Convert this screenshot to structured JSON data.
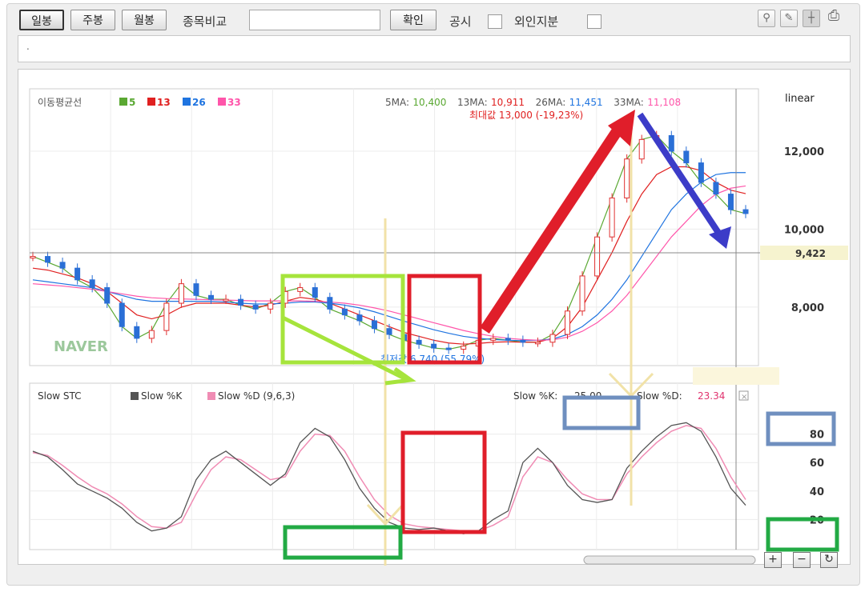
{
  "toolbar": {
    "period_buttons": [
      "일봉",
      "주봉",
      "월봉"
    ],
    "compare_label": "종목비교",
    "compare_value": "",
    "confirm_button": "확인",
    "disclosure_label": "공시",
    "foreign_label": "외인지분"
  },
  "subbar": {
    "text": "."
  },
  "price_chart": {
    "ma_title": "이동평균선",
    "ma_periods": [
      "5",
      "13",
      "26",
      "33"
    ],
    "ma_colors": [
      "#5aa832",
      "#e02020",
      "#1f74e0",
      "#ff55aa"
    ],
    "ma_readout": [
      {
        "label": "5MA:",
        "value": "10,400"
      },
      {
        "label": "13MA:",
        "value": "10,911"
      },
      {
        "label": "26MA:",
        "value": "11,451"
      },
      {
        "label": "33MA:",
        "value": "11,108"
      }
    ],
    "scale_label": "linear",
    "max_label": "최대값 13,000 (-19,23%)",
    "min_label": "최저값 6,740 (55,79%)",
    "current_price": "9,422",
    "watermark": "NAVER",
    "y_ticks": [
      "12,000",
      "10,000",
      "8,000"
    ]
  },
  "stoch_chart": {
    "title": "Slow STC",
    "k_legend": "Slow %K",
    "d_legend": "Slow %D (9,6,3)",
    "readout_k_label": "Slow %K:",
    "readout_k_value": "25.00",
    "readout_d_label": "Slow %D:",
    "readout_d_value": "23.34",
    "y_ticks": [
      "80",
      "60",
      "40",
      "20"
    ]
  },
  "chart_data": {
    "type": "line",
    "price_ylim": [
      6500,
      13600
    ],
    "stoch_ylim": [
      0,
      100
    ],
    "price": {
      "ma5": [
        9300,
        9150,
        9000,
        8700,
        8500,
        8100,
        7500,
        7200,
        7400,
        8100,
        8600,
        8300,
        8200,
        8200,
        8050,
        7950,
        8100,
        8400,
        8500,
        8250,
        7950,
        7800,
        7650,
        7450,
        7300,
        7150,
        7050,
        6950,
        6920,
        7000,
        7150,
        7200,
        7150,
        7100,
        7100,
        7300,
        7900,
        8800,
        9800,
        10800,
        11800,
        12300,
        12400,
        12000,
        11700,
        11200,
        10900,
        10500,
        10400
      ],
      "ma13": [
        9000,
        8950,
        8850,
        8750,
        8600,
        8400,
        8100,
        7800,
        7700,
        7800,
        8000,
        8100,
        8100,
        8100,
        8050,
        8000,
        8050,
        8150,
        8250,
        8200,
        8100,
        7950,
        7800,
        7650,
        7500,
        7350,
        7250,
        7150,
        7080,
        7050,
        7070,
        7100,
        7110,
        7100,
        7100,
        7200,
        7500,
        8000,
        8700,
        9400,
        10200,
        10900,
        11400,
        11600,
        11600,
        11500,
        11200,
        11000,
        10911
      ],
      "ma26": [
        8700,
        8650,
        8600,
        8550,
        8500,
        8400,
        8300,
        8200,
        8150,
        8150,
        8150,
        8150,
        8150,
        8130,
        8100,
        8080,
        8080,
        8100,
        8130,
        8130,
        8100,
        8050,
        7980,
        7880,
        7760,
        7640,
        7530,
        7420,
        7330,
        7250,
        7200,
        7170,
        7150,
        7140,
        7150,
        7180,
        7300,
        7500,
        7800,
        8200,
        8700,
        9300,
        9900,
        10500,
        10900,
        11200,
        11400,
        11451,
        11451
      ],
      "ma33": [
        8600,
        8570,
        8540,
        8500,
        8460,
        8400,
        8340,
        8280,
        8240,
        8220,
        8210,
        8200,
        8190,
        8180,
        8170,
        8160,
        8160,
        8160,
        8160,
        8150,
        8130,
        8100,
        8050,
        7980,
        7900,
        7800,
        7700,
        7600,
        7500,
        7400,
        7320,
        7250,
        7200,
        7170,
        7150,
        7160,
        7230,
        7380,
        7600,
        7900,
        8300,
        8800,
        9300,
        9800,
        10200,
        10600,
        10900,
        11050,
        11108
      ]
    },
    "stoch": {
      "k": [
        68,
        64,
        55,
        45,
        40,
        35,
        28,
        18,
        12,
        14,
        22,
        48,
        62,
        68,
        60,
        52,
        44,
        52,
        74,
        84,
        78,
        62,
        42,
        28,
        18,
        14,
        13,
        14,
        12,
        10,
        12,
        20,
        26,
        60,
        70,
        60,
        44,
        34,
        32,
        34,
        56,
        68,
        78,
        86,
        88,
        82,
        64,
        42,
        30
      ],
      "d": [
        67,
        65,
        58,
        50,
        43,
        38,
        31,
        22,
        15,
        14,
        18,
        38,
        55,
        64,
        62,
        55,
        48,
        50,
        68,
        80,
        79,
        68,
        50,
        34,
        23,
        17,
        15,
        14,
        13,
        12,
        12,
        16,
        22,
        50,
        64,
        60,
        48,
        38,
        34,
        34,
        52,
        64,
        74,
        82,
        86,
        84,
        70,
        50,
        34
      ]
    }
  }
}
